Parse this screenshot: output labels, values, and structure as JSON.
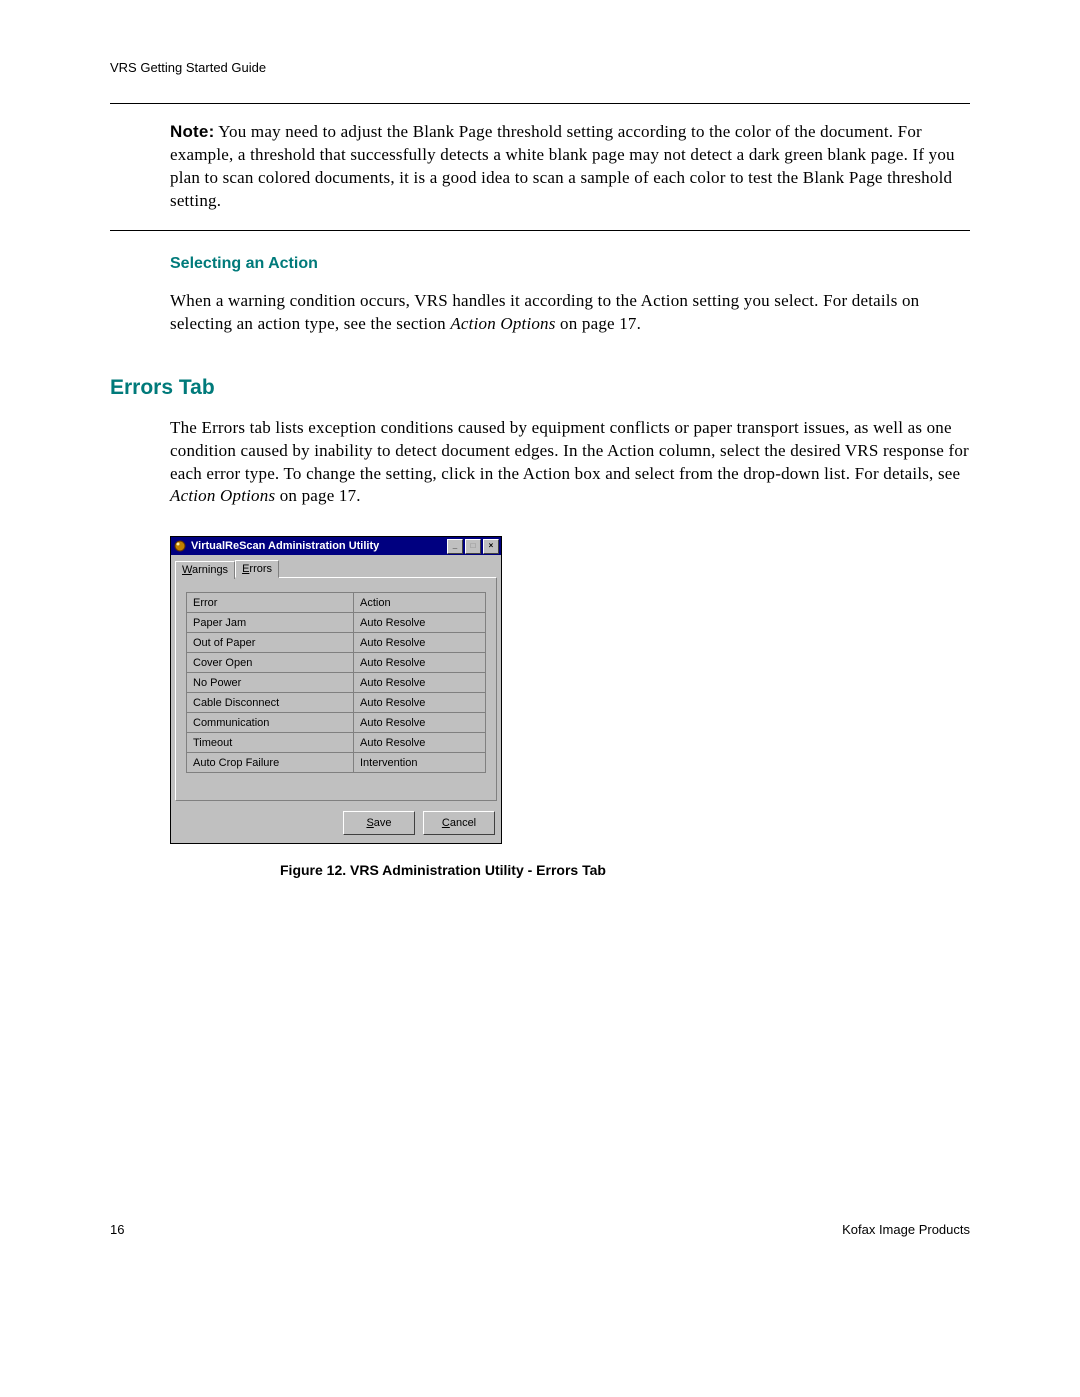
{
  "header": {
    "running": "VRS Getting Started Guide"
  },
  "note": {
    "label": "Note:",
    "text": "You may need to adjust the Blank Page threshold setting according to the color of the document. For example, a threshold that successfully detects a white blank page may not detect a dark green blank page. If you plan to scan colored documents, it is a good idea to scan a sample of each color to test the Blank Page threshold setting."
  },
  "selecting_action": {
    "heading": "Selecting an Action",
    "para_a": "When a warning condition occurs, VRS handles it according to the Action setting you select. For details on selecting an action type, see the section ",
    "para_italic": "Action Options",
    "para_b": " on page 17."
  },
  "errors_tab": {
    "heading": "Errors Tab",
    "para_a": "The Errors tab lists exception conditions caused by equipment conflicts or paper transport issues, as well as one condition caused by inability to detect document edges. In the Action column, select the desired VRS response for each error type. To change the setting, click in the Action box and select from the drop-down list. For details, see ",
    "para_italic": "Action Options",
    "para_b": " on page 17."
  },
  "dialog": {
    "title": "VirtualReScan Administration Utility",
    "tabs": {
      "warnings": "Warnings",
      "errors": "Errors"
    },
    "columns": {
      "error": "Error",
      "action": "Action"
    },
    "rows": [
      {
        "error": "Paper Jam",
        "action": "Auto Resolve"
      },
      {
        "error": "Out of Paper",
        "action": "Auto Resolve"
      },
      {
        "error": "Cover Open",
        "action": "Auto Resolve"
      },
      {
        "error": "No Power",
        "action": "Auto Resolve"
      },
      {
        "error": "Cable Disconnect",
        "action": "Auto Resolve"
      },
      {
        "error": "Communication",
        "action": "Auto Resolve"
      },
      {
        "error": "Timeout",
        "action": "Auto Resolve"
      },
      {
        "error": "Auto Crop Failure",
        "action": "Intervention"
      }
    ],
    "save": "Save",
    "cancel": "Cancel"
  },
  "figure_caption": "Figure 12.   VRS Administration Utility - Errors Tab",
  "footer": {
    "page": "16",
    "brand": "Kofax Image Products"
  }
}
